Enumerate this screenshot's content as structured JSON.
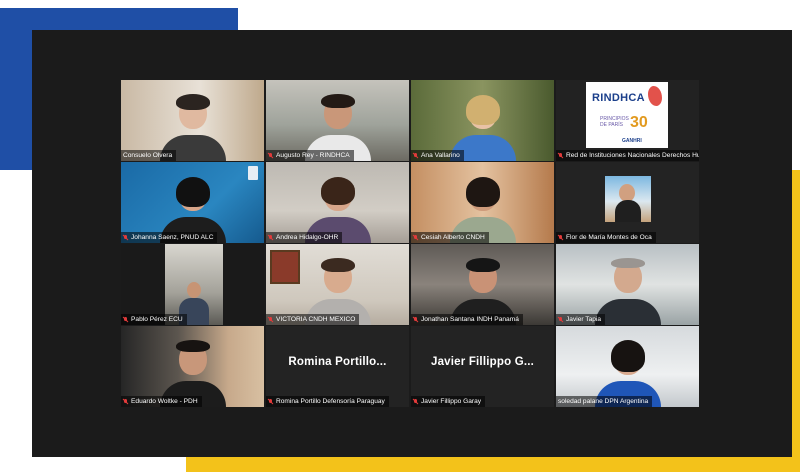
{
  "participants": [
    {
      "name": "Consuelo Olvera",
      "muted": false
    },
    {
      "name": "Augusto Rey - RINDHCA",
      "muted": true
    },
    {
      "name": "Ana Vallarino",
      "muted": true
    },
    {
      "name": "Red de Instituciones Nacionales Derechos Hu...",
      "muted": true
    },
    {
      "name": "Johanna Saenz, PNUD ALC",
      "muted": true
    },
    {
      "name": "Andrea Hidalgo-OHR",
      "muted": true
    },
    {
      "name": "Cesiah Alberto CNDH",
      "muted": true
    },
    {
      "name": "Flor de María Montes de Oca",
      "muted": true
    },
    {
      "name": "Pablo Pérez ECU",
      "muted": true
    },
    {
      "name": "VICTORIA CNDH MEXICO",
      "muted": true
    },
    {
      "name": "Jonathan Santana INDH Panamá",
      "muted": true
    },
    {
      "name": "Javier Tapia",
      "muted": true
    },
    {
      "name": "Eduardo Woltke - PDH",
      "muted": true
    },
    {
      "name": "Romina Portillo Defensoría Paraguay",
      "muted": true
    },
    {
      "name": "Javier Fillippo Garay",
      "muted": true
    },
    {
      "name": "soledad palane DPN Argentina",
      "muted": false
    }
  ],
  "no_video_labels": {
    "romina": "Romina  Portillo...",
    "javier": "Javier  Fillippo  G..."
  },
  "logo": {
    "title": "RINDHCA",
    "subtitle_line1": "PRINCIPIOS",
    "subtitle_line2": "DE PARÍS",
    "number": "30",
    "org": "GANHRI"
  },
  "colors": {
    "deco_blue": "#1f4fa6",
    "deco_yellow": "#f3c21a",
    "screen_bg": "#1b1b1b",
    "muted_icon": "#e23b3b",
    "active_speaker_border": "#cfe05f"
  }
}
